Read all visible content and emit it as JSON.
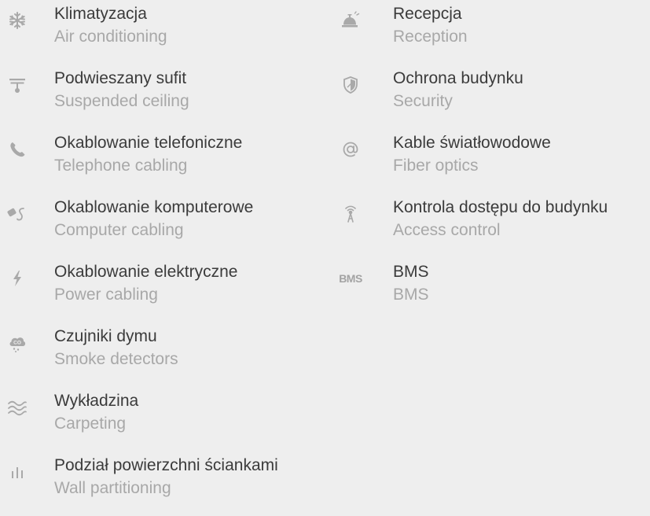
{
  "left_column": [
    {
      "icon": "snowflake-icon",
      "pl": "Klimatyzacja",
      "en": "Air conditioning"
    },
    {
      "icon": "ceiling-lamp-icon",
      "pl": "Podwieszany sufit",
      "en": "Suspended ceiling"
    },
    {
      "icon": "phone-icon",
      "pl": "Okablowanie telefoniczne",
      "en": "Telephone cabling"
    },
    {
      "icon": "network-cable-icon",
      "pl": "Okablowanie komputerowe",
      "en": "Computer cabling"
    },
    {
      "icon": "lightning-icon",
      "pl": "Okablowanie elektryczne",
      "en": "Power cabling"
    },
    {
      "icon": "co-smoke-icon",
      "pl": "Czujniki dymu",
      "en": "Smoke detectors"
    },
    {
      "icon": "waves-icon",
      "pl": "Wykładzina",
      "en": "Carpeting"
    },
    {
      "icon": "partition-bars-icon",
      "pl": "Podział powierzchni ściankami",
      "en": "Wall partitioning"
    }
  ],
  "right_column": [
    {
      "icon": "service-bell-icon",
      "pl": "Recepcja",
      "en": "Reception"
    },
    {
      "icon": "shield-icon",
      "pl": "Ochrona budynku",
      "en": "Security"
    },
    {
      "icon": "at-sign-icon",
      "pl": "Kable światłowodowe",
      "en": "Fiber optics"
    },
    {
      "icon": "antenna-icon",
      "pl": "Kontrola dostępu do budynku",
      "en": "Access control"
    },
    {
      "icon": "bms-icon",
      "pl": "BMS",
      "en": "BMS",
      "icon_text": "BMS"
    }
  ]
}
